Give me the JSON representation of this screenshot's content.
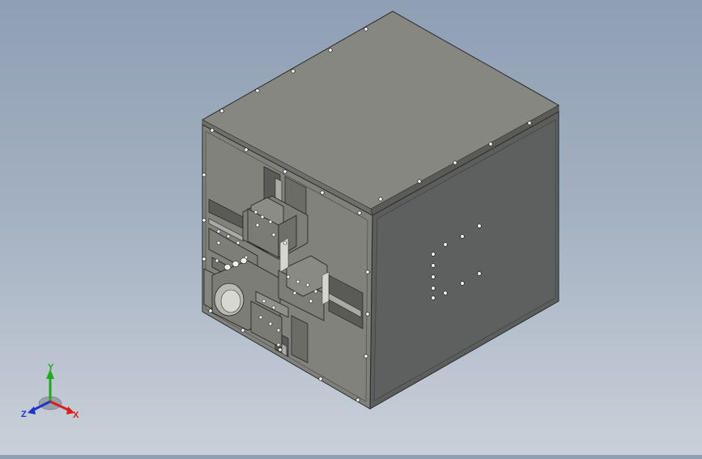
{
  "viewport": {
    "background_top": "#8f9fb4",
    "background_bottom": "#c9d0d9"
  },
  "model": {
    "top_face_color": "#858780",
    "front_face_color": "#80817a",
    "right_face_color": "#5c5d5d",
    "edge_color": "#2a2a2a"
  },
  "triad": {
    "x_label": "X",
    "y_label": "Y",
    "z_label": "Z",
    "x_color": "#d81e1e",
    "y_color": "#1faa1f",
    "z_color": "#2233cc"
  }
}
